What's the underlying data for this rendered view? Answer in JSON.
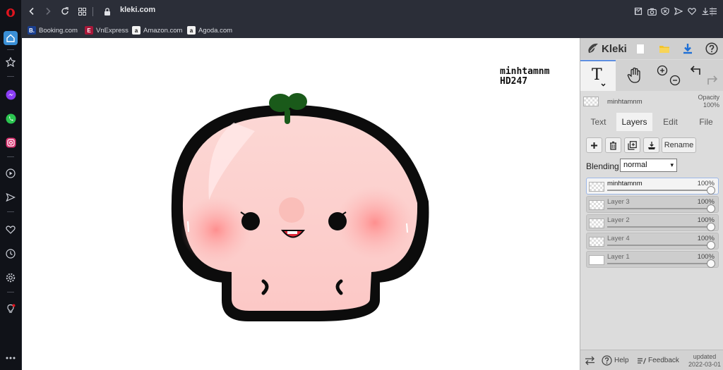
{
  "browser": {
    "url": "kleki.com",
    "bookmarks": [
      {
        "label": "Booking.com",
        "icon": "B.",
        "color": "#1a3f8f"
      },
      {
        "label": "VnExpress",
        "icon": "E",
        "color": "#a8183a"
      },
      {
        "label": "Amazon.com",
        "icon": "a",
        "color": "#ffffff"
      },
      {
        "label": "Agoda.com",
        "icon": "a",
        "color": "#ffffff"
      }
    ]
  },
  "canvas": {
    "signature_line1": "minhtamnm",
    "signature_line2": "HD247"
  },
  "panel": {
    "brand": "Kleki",
    "current_layer_name": "minhtamnm",
    "opacity_label": "Opacity",
    "opacity_value": "100%",
    "tabs": [
      "Text",
      "Layers",
      "Edit",
      "File"
    ],
    "active_tab": "Layers",
    "rename_label": "Rename",
    "blending_label": "Blending",
    "blending_value": "normal",
    "layers": [
      {
        "name": "minhtamnm",
        "opacity": "100%",
        "selected": true
      },
      {
        "name": "Layer 3",
        "opacity": "100%",
        "selected": false
      },
      {
        "name": "Layer 2",
        "opacity": "100%",
        "selected": false
      },
      {
        "name": "Layer 4",
        "opacity": "100%",
        "selected": false
      },
      {
        "name": "Layer 1",
        "opacity": "100%",
        "selected": false
      }
    ],
    "help_label": "Help",
    "feedback_label": "Feedback",
    "updated_label": "updated",
    "updated_date": "2022-03-01"
  },
  "colors": {
    "accent": "#5e8fe0",
    "sidebar_bg": "#101218",
    "chrome_bg": "#2b2e38",
    "panel_bg": "#dcdcdc"
  }
}
